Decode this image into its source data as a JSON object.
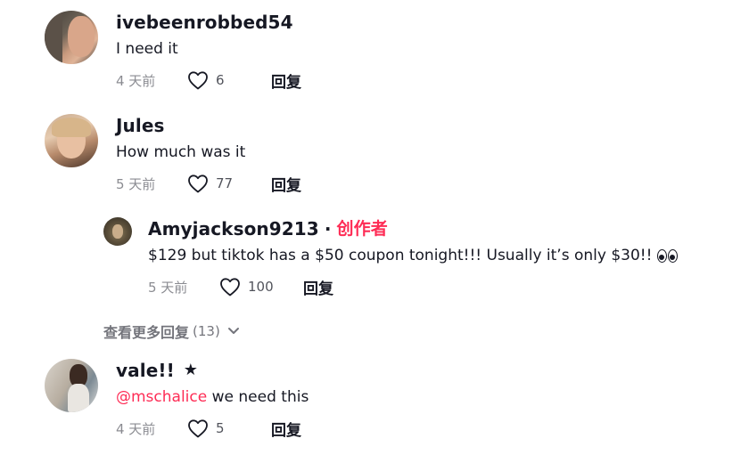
{
  "comments": [
    {
      "username": "ivebeenrobbed54",
      "text": "I need it",
      "time": "4 天前",
      "likes": "6",
      "reply_label": "回复"
    },
    {
      "username": "Jules",
      "text": "How much was it",
      "time": "5 天前",
      "likes": "77",
      "reply_label": "回复",
      "reply": {
        "username": "Amyjackson9213",
        "separator": "·",
        "author_tag": "创作者",
        "text": "$129 but tiktok has a $50 coupon tonight!!! Usually it’s only $30!!",
        "time": "5 天前",
        "likes": "100",
        "reply_label": "回复"
      }
    },
    {
      "username": "vale!!",
      "star": "★",
      "mention": "@mschalice",
      "text": " we need this",
      "time": "4 天前",
      "likes": "5",
      "reply_label": "回复"
    }
  ],
  "more_replies": {
    "label": "查看更多回复",
    "count": "(13)"
  },
  "colors": {
    "accent": "#fe2c55",
    "text": "#161823"
  }
}
